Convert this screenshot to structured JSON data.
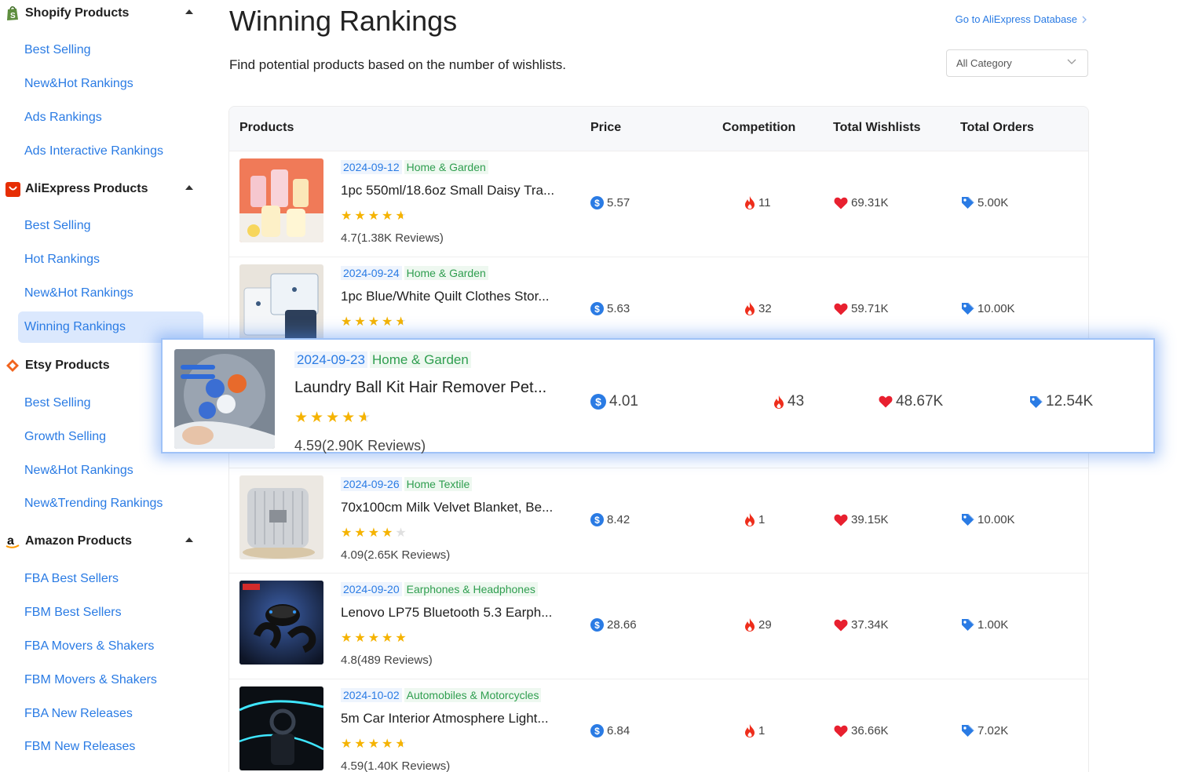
{
  "sidebar": {
    "sections": [
      {
        "title": "Shopify Products",
        "logo": "shopify-logo",
        "items": [
          "Best Selling",
          "New&Hot Rankings",
          "Ads Rankings",
          "Ads Interactive Rankings"
        ]
      },
      {
        "title": "AliExpress Products",
        "logo": "aliexpress-logo",
        "items": [
          "Best Selling",
          "Hot Rankings",
          "New&Hot Rankings",
          "Winning Rankings"
        ]
      },
      {
        "title": "Etsy Products",
        "logo": "etsy-logo",
        "items": [
          "Best Selling",
          "Growth Selling",
          "New&Hot Rankings",
          "New&Trending Rankings"
        ]
      },
      {
        "title": "Amazon Products",
        "logo": "amazon-logo",
        "items": [
          "FBA Best Sellers",
          "FBM Best Sellers",
          "FBA Movers & Shakers",
          "FBM Movers & Shakers",
          "FBA New Releases",
          "FBM New Releases"
        ]
      }
    ],
    "active_item": "Winning Rankings"
  },
  "header": {
    "title": "Winning Rankings",
    "subtitle": "Find potential products based on the number of wishlists.",
    "db_link": "Go to AliExpress Database",
    "category_select": "All Category"
  },
  "table": {
    "columns": [
      "Products",
      "Price",
      "Competition",
      "Total Wishlists",
      "Total Orders"
    ],
    "rows": [
      {
        "date": "2024-09-12",
        "category": "Home & Garden",
        "name": "1pc 550ml/18.6oz Small Daisy Tra...",
        "stars": 4.5,
        "rating": "4.7(1.38K Reviews)",
        "price": "5.57",
        "competition": "11",
        "wishlists": "69.31K",
        "orders": "5.00K",
        "thumb": "water-bottles"
      },
      {
        "date": "2024-09-24",
        "category": "Home & Garden",
        "name": "1pc Blue/White Quilt Clothes Stor...",
        "stars": 4.5,
        "rating": "",
        "price": "5.63",
        "competition": "32",
        "wishlists": "59.71K",
        "orders": "10.00K",
        "thumb": "storage-bags"
      },
      {
        "date": "2024-09-26",
        "category": "Home Textile",
        "name": "70x100cm Milk Velvet Blanket, Be...",
        "stars": 4,
        "rating": "4.09(2.65K Reviews)",
        "price": "8.42",
        "competition": "1",
        "wishlists": "39.15K",
        "orders": "10.00K",
        "thumb": "blanket"
      },
      {
        "date": "2024-09-20",
        "category": "Earphones & Headphones",
        "name": "Lenovo LP75 Bluetooth 5.3 Earph...",
        "stars": 5,
        "rating": "4.8(489 Reviews)",
        "price": "28.66",
        "competition": "29",
        "wishlists": "37.34K",
        "orders": "1.00K",
        "thumb": "earphones"
      },
      {
        "date": "2024-10-02",
        "category": "Automobiles & Motorcycles",
        "name": "5m Car Interior Atmosphere Light...",
        "stars": 4.5,
        "rating": "4.59(1.40K Reviews)",
        "price": "6.84",
        "competition": "1",
        "wishlists": "36.66K",
        "orders": "7.02K",
        "thumb": "car-lights"
      }
    ],
    "highlight": {
      "date": "2024-09-23",
      "category": "Home & Garden",
      "name": "Laundry Ball Kit Hair Remover Pet...",
      "stars": 4.5,
      "rating": "4.59(2.90K Reviews)",
      "price": "4.01",
      "competition": "43",
      "wishlists": "48.67K",
      "orders": "12.54K",
      "thumb": "laundry-balls"
    }
  }
}
